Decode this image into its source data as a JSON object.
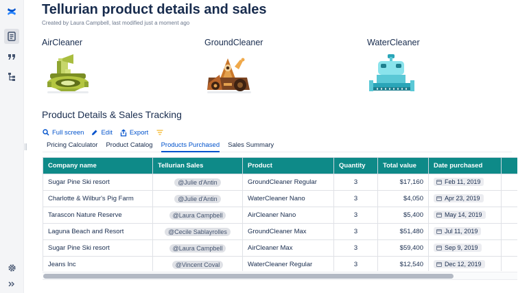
{
  "sidebar": {
    "icons": [
      "confluence-logo-icon",
      "page-icon",
      "quote-icon",
      "page-tree-icon",
      "settings-icon",
      "expand-icon"
    ]
  },
  "page": {
    "title": "Tellurian product details and sales",
    "byline": "Created by Laura Campbell, last modified just a moment ago"
  },
  "products": [
    {
      "name": "AirCleaner",
      "icon": "aircleaner-robot-icon"
    },
    {
      "name": "GroundCleaner",
      "icon": "groundcleaner-robot-icon"
    },
    {
      "name": "WaterCleaner",
      "icon": "watercleaner-robot-icon"
    }
  ],
  "section": {
    "title": "Product Details & Sales Tracking"
  },
  "actions": {
    "full_screen": "Full screen",
    "edit": "Edit",
    "export": "Export"
  },
  "tabs": [
    {
      "label": "Pricing Calculator",
      "active": false
    },
    {
      "label": "Product Catalog",
      "active": false
    },
    {
      "label": "Products Purchased",
      "active": true
    },
    {
      "label": "Sales Summary",
      "active": false
    }
  ],
  "table": {
    "headers": [
      "Company name",
      "Tellurian Sales",
      "Product",
      "Quantity",
      "Total value",
      "Date purchased"
    ],
    "rows": [
      {
        "company": "Sugar Pine Ski resort",
        "sales": "@Julie d'Antin",
        "product": "GroundCleaner Regular",
        "quantity": "3",
        "total": "$17,160",
        "date": "Feb 11, 2019"
      },
      {
        "company": "Charlotte & Wilbur's Pig Farm",
        "sales": "@Julie d'Antin",
        "product": "WaterCleaner Nano",
        "quantity": "3",
        "total": "$4,050",
        "date": "Apr 23, 2019"
      },
      {
        "company": "Tarascon Nature Reserve",
        "sales": "@Laura Campbell",
        "product": "AirCleaner Nano",
        "quantity": "3",
        "total": "$5,400",
        "date": "May 14, 2019"
      },
      {
        "company": "Laguna Beach and Resort",
        "sales": "@Cecile Sablayrolles",
        "product": "GroundCleaner Max",
        "quantity": "3",
        "total": "$51,480",
        "date": "Jul 11, 2019"
      },
      {
        "company": "Sugar Pine Ski resort",
        "sales": "@Laura Campbell",
        "product": "AirCleaner Max",
        "quantity": "3",
        "total": "$59,400",
        "date": "Sep 9, 2019"
      },
      {
        "company": "Jeans Inc",
        "sales": "@Vincent Coval",
        "product": "WaterCleaner Regular",
        "quantity": "3",
        "total": "$12,540",
        "date": "Dec 12, 2019"
      }
    ]
  },
  "colors": {
    "header_teal": "#0e8a88",
    "link_blue": "#0052cc",
    "text_dark": "#172b4d"
  }
}
